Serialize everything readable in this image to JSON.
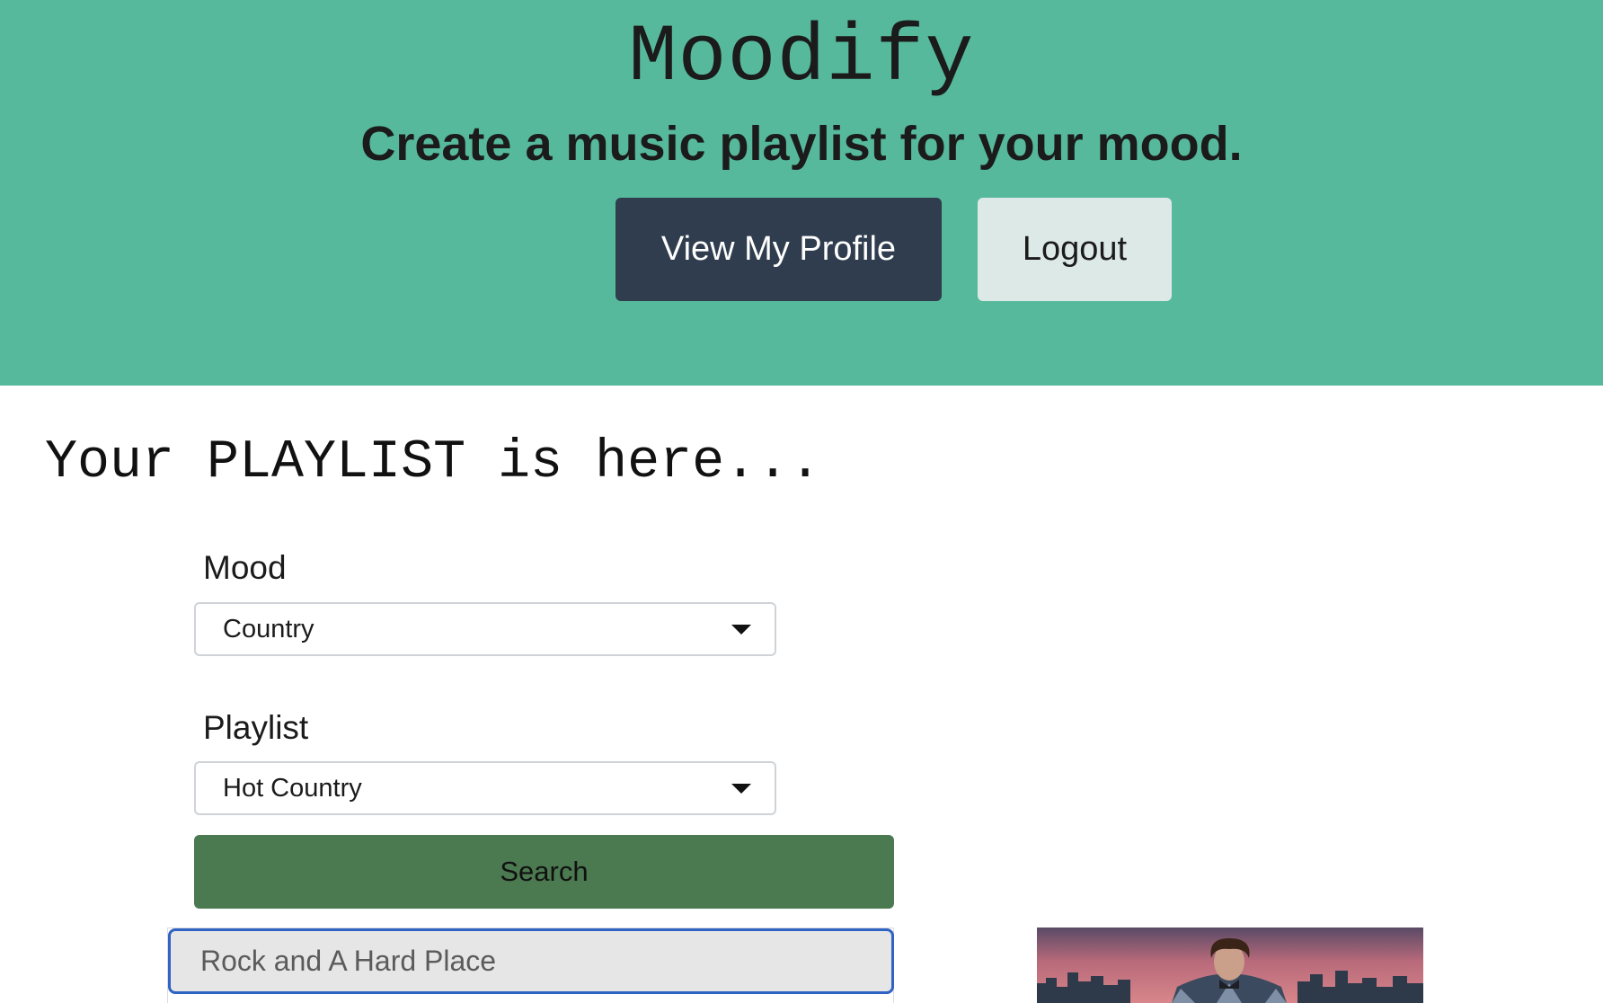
{
  "header": {
    "app_title": "Moodify",
    "tagline": "Create a music playlist for your mood.",
    "profile_button": "View My Profile",
    "logout_button": "Logout"
  },
  "main": {
    "section_title": "Your PLAYLIST is here...",
    "mood": {
      "label": "Mood",
      "selected": "Country"
    },
    "playlist": {
      "label": "Playlist",
      "selected": "Hot Country"
    },
    "search_button": "Search",
    "results": [
      {
        "title": "Rock and A Hard Place"
      }
    ]
  },
  "colors": {
    "hero_background": "#57b99c",
    "profile_button": "#2f3d4e",
    "logout_button": "#dde9e7",
    "search_button": "#4b7a50",
    "focus_ring": "#2f63c4"
  },
  "icons": {
    "select_caret": "caret-down-icon",
    "album_art": "album-cover-image"
  }
}
